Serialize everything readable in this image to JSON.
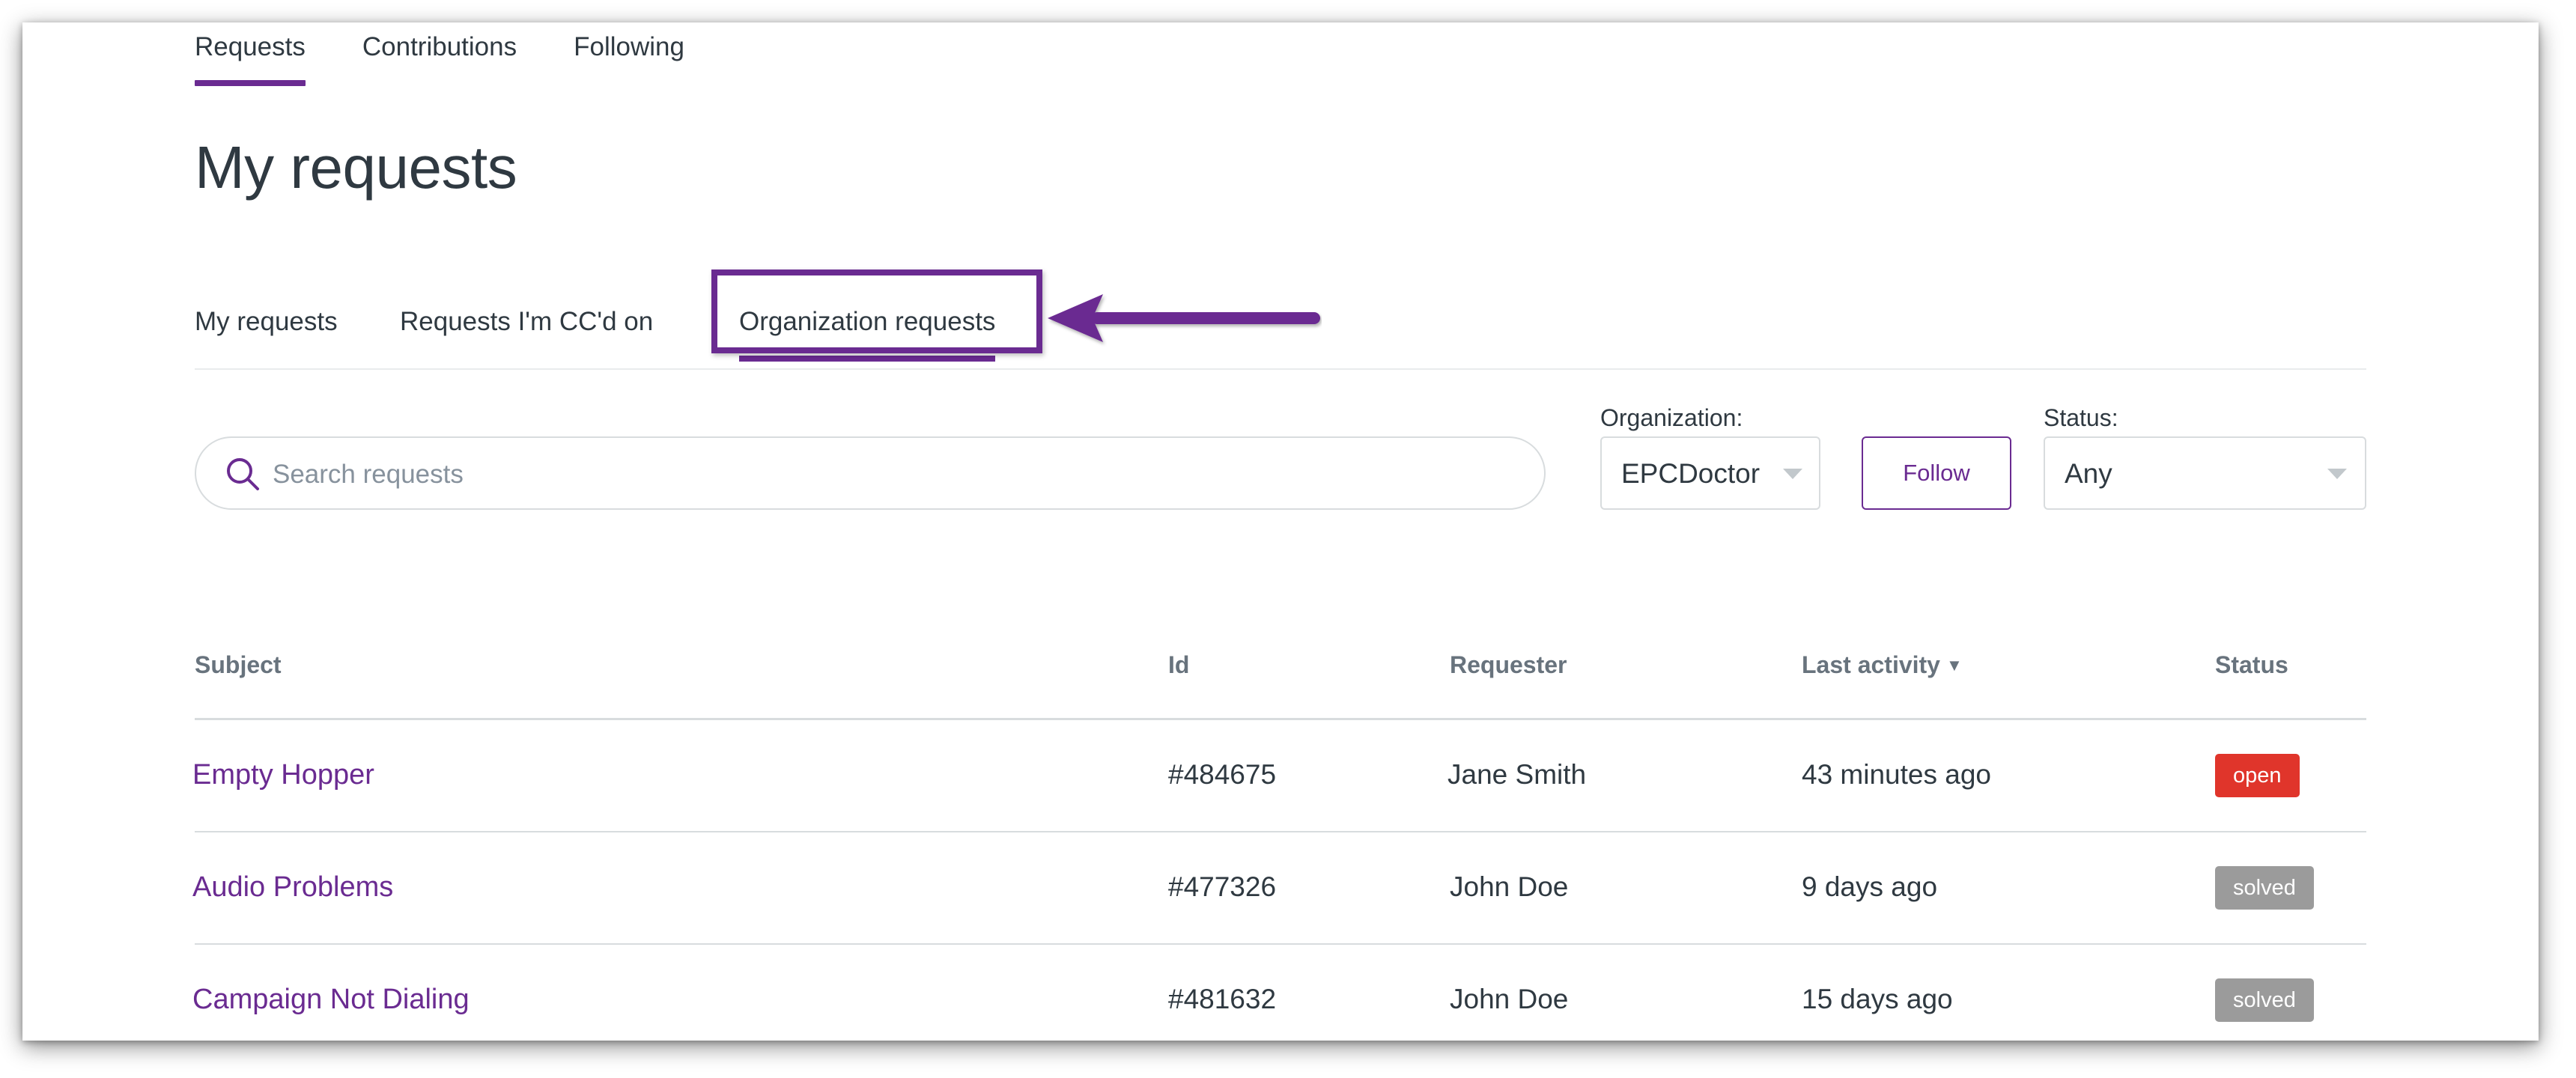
{
  "top_nav": {
    "tabs": [
      {
        "label": "Requests",
        "active": true
      },
      {
        "label": "Contributions",
        "active": false
      },
      {
        "label": "Following",
        "active": false
      }
    ]
  },
  "page_title": "My requests",
  "sub_nav": {
    "tabs": [
      {
        "label": "My requests",
        "active": false
      },
      {
        "label": "Requests I'm CC'd on",
        "active": false
      },
      {
        "label": "Organization requests",
        "active": true
      }
    ]
  },
  "annotation": {
    "color": "#6a2b91",
    "highlight_target": "Organization requests"
  },
  "filters": {
    "search_placeholder": "Search requests",
    "organization_label": "Organization:",
    "organization_value": "EPCDoctor",
    "follow_label": "Follow",
    "status_label": "Status:",
    "status_value": "Any"
  },
  "table": {
    "headers": {
      "subject": "Subject",
      "id": "Id",
      "requester": "Requester",
      "last_activity": "Last activity",
      "status": "Status"
    },
    "sort_indicator": "▼",
    "rows": [
      {
        "subject": "Empty Hopper",
        "id": "#484675",
        "requester": "Jane Smith",
        "last_activity": "43 minutes ago",
        "status": "open"
      },
      {
        "subject": "Audio Problems",
        "id": "#477326",
        "requester": "John Doe",
        "last_activity": "9 days ago",
        "status": "solved"
      },
      {
        "subject": "Campaign Not Dialing",
        "id": "#481632",
        "requester": "John Doe",
        "last_activity": "15 days ago",
        "status": "solved"
      }
    ]
  },
  "colors": {
    "accent": "#6a2b91",
    "status_open": "#e0352b",
    "status_solved": "#9b9b9b"
  }
}
